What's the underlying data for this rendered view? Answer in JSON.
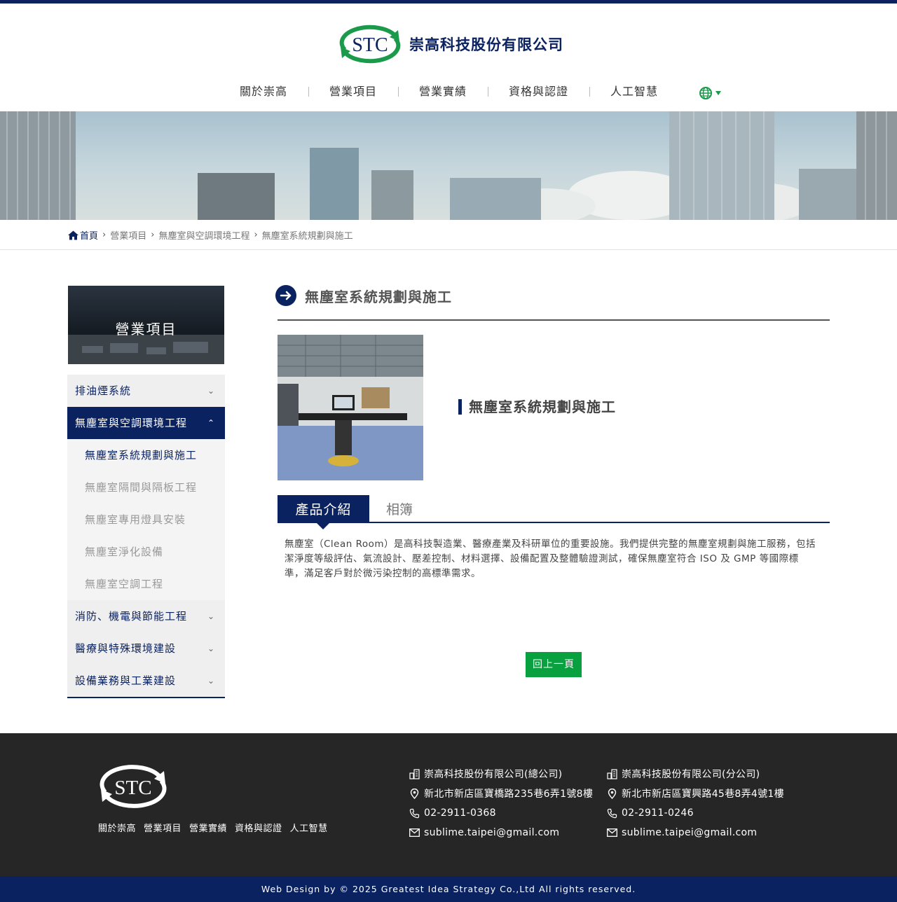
{
  "colors": {
    "navy": "#0b2260",
    "green": "#09a13f",
    "footer_bg": "#262626"
  },
  "brand": {
    "logo_letters": "STC",
    "company_name": "崇高科技股份有限公司"
  },
  "nav": {
    "items": [
      "關於崇高",
      "營業項目",
      "營業實績",
      "資格與認證",
      "人工智慧"
    ],
    "language_icon": "globe-icon"
  },
  "breadcrumb": {
    "home": "首頁",
    "items": [
      "營業項目",
      "無塵室與空調環境工程",
      "無塵室系統規劃與施工"
    ]
  },
  "sidebar": {
    "title": "營業項目",
    "categories": [
      {
        "label": "排油煙系統"
      },
      {
        "label": "無塵室與空調環境工程",
        "expanded": true
      },
      {
        "label": "消防、機電與節能工程"
      },
      {
        "label": "醫療與特殊環境建設"
      },
      {
        "label": "設備業務與工業建設"
      }
    ],
    "subitems": [
      "無塵室系統規劃與施工",
      "無塵室隔間與隔板工程",
      "無塵室專用燈具安裝",
      "無塵室淨化設備",
      "無塵室空調工程"
    ]
  },
  "content": {
    "page_title": "無塵室系統規劃與施工",
    "product_name": "無塵室系統規劃與施工",
    "tabs": [
      "產品介紹",
      "相簿"
    ],
    "description": "無塵室（Clean Room）是高科技製造業、醫療產業及科研單位的重要設施。我們提供完整的無塵室規劃與施工服務，包括潔淨度等級評估、氣流設計、壓差控制、材料選擇、設備配置及整體驗證測試，確保無塵室符合 ISO 及 GMP 等國際標準，滿足客戶對於微污染控制的高標準需求。",
    "back_button": "回上一頁"
  },
  "footer": {
    "links": [
      "關於崇高",
      "營業項目",
      "營業實績",
      "資格與認證",
      "人工智慧"
    ],
    "offices": [
      {
        "name": "崇高科技股份有限公司(總公司)",
        "address": "新北市新店區寶橋路235巷6弄1號8樓",
        "phone": "02-2911-0368",
        "email": "sublime.taipei@gmail.com"
      },
      {
        "name": "崇高科技股份有限公司(分公司)",
        "address": "新北市新店區寶興路45巷8弄4號1樓",
        "phone": "02-2911-0246",
        "email": "sublime.taipei@gmail.com"
      }
    ],
    "copyright": "Web Design by © 2025 Greatest Idea Strategy Co.,Ltd All rights reserved."
  }
}
